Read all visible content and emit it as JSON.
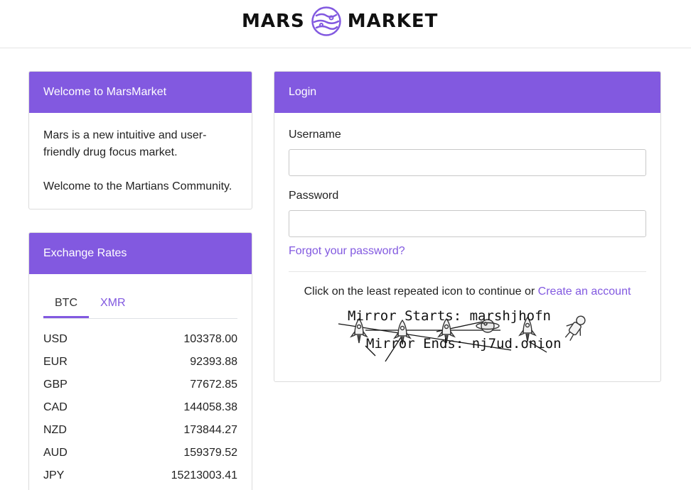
{
  "header": {
    "logo_left": "MARS",
    "logo_right": "MARKET",
    "brand_color": "#8259e0"
  },
  "welcome": {
    "title": "Welcome to MarsMarket",
    "line1": "Mars is a new intuitive and user-friendly drug focus market.",
    "line2": "Welcome to the Martians Community."
  },
  "rates": {
    "title": "Exchange Rates",
    "tabs": [
      {
        "label": "BTC",
        "active": true
      },
      {
        "label": "XMR",
        "active": false
      }
    ],
    "rows": [
      {
        "currency": "USD",
        "value": "103378.00"
      },
      {
        "currency": "EUR",
        "value": "92393.88"
      },
      {
        "currency": "GBP",
        "value": "77672.85"
      },
      {
        "currency": "CAD",
        "value": "144058.38"
      },
      {
        "currency": "NZD",
        "value": "173844.27"
      },
      {
        "currency": "AUD",
        "value": "159379.52"
      },
      {
        "currency": "JPY",
        "value": "15213003.41"
      }
    ]
  },
  "login": {
    "title": "Login",
    "username_label": "Username",
    "username_value": "",
    "password_label": "Password",
    "password_value": "",
    "forgot_label": "Forgot your password?",
    "captcha_prompt": "Click on the least repeated icon to continue or",
    "create_account_label": "Create an account",
    "captcha": {
      "mirror_start_text": "Mirror Starts: marshjhofn",
      "mirror_end_text": "Mirror Ends: nj7ud.onion",
      "icons": [
        "rocket-icon",
        "rocket-icon",
        "rocket-icon",
        "planet-icon",
        "rocket-icon",
        "astronaut-icon"
      ]
    }
  }
}
